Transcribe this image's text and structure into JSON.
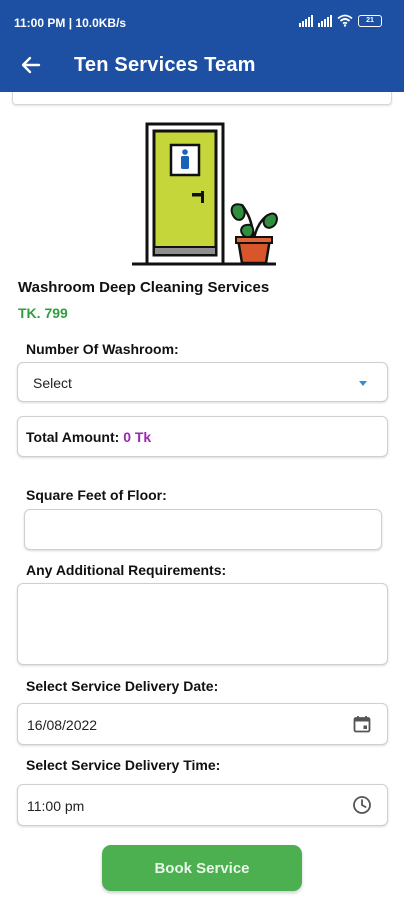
{
  "status_bar": {
    "time_speed": "11:00 PM | 10.0KB/s",
    "battery": "21",
    "icons": [
      "signal-icon",
      "signal-icon",
      "wifi-icon",
      "battery-icon"
    ]
  },
  "header": {
    "title": "Ten Services Team",
    "back_icon": "arrow-left-icon",
    "background_color": "#1d4fa3"
  },
  "service": {
    "name": "Washroom Deep Cleaning Services",
    "price": "TK. 799",
    "price_color": "#2e9e41",
    "illustration": "washroom-door-with-plant"
  },
  "form": {
    "washroom_count": {
      "label": "Number Of Washroom:",
      "value": "Select"
    },
    "total": {
      "label": "Total Amount:",
      "value": "0 Tk",
      "value_color": "#9c27b0"
    },
    "square_feet": {
      "label": "Square Feet of Floor:",
      "value": ""
    },
    "requirements": {
      "label": "Any Additional Requirements:",
      "value": ""
    },
    "delivery_date": {
      "label": "Select Service Delivery Date:",
      "value": "16/08/2022",
      "icon": "calendar-icon"
    },
    "delivery_time": {
      "label": "Select Service Delivery Time:",
      "value": "11:00 pm",
      "icon": "clock-icon"
    }
  },
  "book_button": {
    "label": "Book Service",
    "color": "#4caf50"
  }
}
